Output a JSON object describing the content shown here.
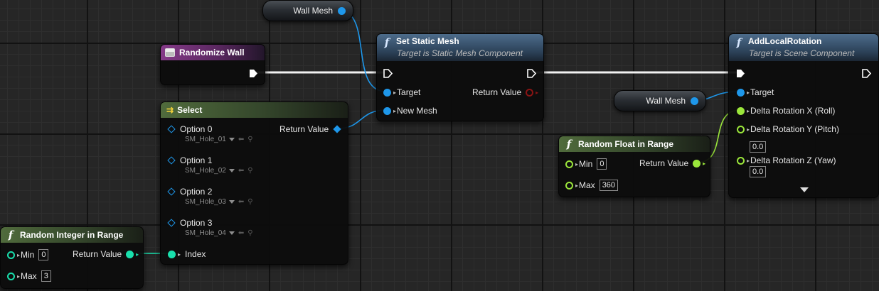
{
  "colors": {
    "object_pin": "#1e97ea",
    "float_pin": "#9be63b",
    "int_pin": "#19e0ad",
    "exec_pin": "#ffffff",
    "function_header": "#4d6c8b",
    "pure_header": "#506b3c",
    "event_header": "#853a88"
  },
  "wall_mesh_top": {
    "label": "Wall Mesh"
  },
  "wall_mesh_right": {
    "label": "Wall Mesh"
  },
  "randomize_wall": {
    "title": "Randomize Wall",
    "icon": "custom-event-icon"
  },
  "set_static_mesh": {
    "icon": "function-icon",
    "title": "Set Static Mesh",
    "subtitle": "Target is Static Mesh Component",
    "target_label": "Target",
    "new_mesh_label": "New Mesh",
    "return_label": "Return Value"
  },
  "add_local_rotation": {
    "icon": "function-icon",
    "title": "AddLocalRotation",
    "subtitle": "Target is Scene Component",
    "target_label": "Target",
    "x_label": "Delta Rotation X (Roll)",
    "y_label": "Delta Rotation Y (Pitch)",
    "y_value": "0.0",
    "z_label": "Delta Rotation Z (Yaw)",
    "z_value": "0.0"
  },
  "select_node": {
    "icon": "select-icon",
    "title": "Select",
    "return_label": "Return Value",
    "index_label": "Index",
    "options": [
      {
        "label": "Option 0",
        "asset": "SM_Hole_01"
      },
      {
        "label": "Option 1",
        "asset": "SM_Hole_02"
      },
      {
        "label": "Option 2",
        "asset": "SM_Hole_03"
      },
      {
        "label": "Option 3",
        "asset": "SM_Hole_04"
      }
    ]
  },
  "random_float": {
    "icon": "function-icon",
    "title": "Random Float in Range",
    "min_label": "Min",
    "min_value": "0",
    "max_label": "Max",
    "max_value": "360",
    "return_label": "Return Value"
  },
  "random_int": {
    "icon": "function-icon",
    "title": "Random Integer in Range",
    "min_label": "Min",
    "min_value": "0",
    "max_label": "Max",
    "max_value": "3",
    "return_label": "Return Value"
  }
}
